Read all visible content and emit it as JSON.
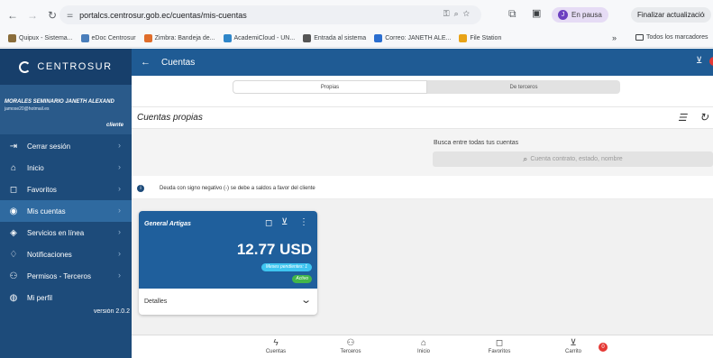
{
  "browser": {
    "url": "portalcs.centrosur.gob.ec/cuentas/mis-cuentas",
    "profile_label": "En pausa",
    "update_label": "Finalizar actualización",
    "bookmarks": [
      {
        "label": "Quipux - Sistema...",
        "color": "#8a6d3b"
      },
      {
        "label": "eDoc Centrosur",
        "color": "#4a7ebb"
      },
      {
        "label": "Zimbra: Bandeja de...",
        "color": "#e06d2b"
      },
      {
        "label": "AcademiCloud - UN...",
        "color": "#2f86c9"
      },
      {
        "label": "Entrada al sistema",
        "color": "#555555"
      },
      {
        "label": "Correo: JANETH ALE...",
        "color": "#2b6ecf"
      },
      {
        "label": "File Station",
        "color": "#e8a317"
      }
    ],
    "more_label": "»",
    "all_bookmarks_label": "Todos los marcadores"
  },
  "sidebar": {
    "brand": "CENTROSUR",
    "user_name": "MORALES SEMINARIO JANETH ALEXAND",
    "user_email": "jamose20@hotmail.es",
    "user_role": "cliente",
    "items": [
      {
        "label": "Cerrar sesión",
        "icon": "logout-icon",
        "glyph": "⇥"
      },
      {
        "label": "Inicio",
        "icon": "home-icon",
        "glyph": "⌂"
      },
      {
        "label": "Favoritos",
        "icon": "bookmark-icon",
        "glyph": "◻"
      },
      {
        "label": "Mis cuentas",
        "icon": "database-icon",
        "glyph": "◉"
      },
      {
        "label": "Servicios en línea",
        "icon": "services-icon",
        "glyph": "◈"
      },
      {
        "label": "Notificaciones",
        "icon": "bell-icon",
        "glyph": "♢"
      },
      {
        "label": "Permisos - Terceros",
        "icon": "users-icon",
        "glyph": "⚇"
      },
      {
        "label": "Mi perfil",
        "icon": "profile-icon",
        "glyph": "◍"
      }
    ],
    "version": "versión 2.0.2"
  },
  "appbar": {
    "title": "Cuentas",
    "back_icon": "arrow-left-icon",
    "cart_icon": "cart-icon"
  },
  "tabs": {
    "own": "Propias",
    "third": "De terceros"
  },
  "section": {
    "title": "Cuentas propias"
  },
  "search": {
    "label": "Busca entre todas tus cuentas",
    "placeholder": "Cuenta contrato, estado, nombre"
  },
  "notice": "Deuda con signo negativo (-) se debe a saldos a favor del cliente",
  "card": {
    "name": "General Artigas",
    "amount": "12.77 USD",
    "pending_badge": "Meses pendientes: 1",
    "status_badge": "Activo",
    "details_label": "Detalles"
  },
  "bottom_nav": [
    {
      "label": "Cuentas",
      "icon": "bolt-icon",
      "glyph": "ϟ"
    },
    {
      "label": "Terceros",
      "icon": "users-icon",
      "glyph": "⚇"
    },
    {
      "label": "Inicio",
      "icon": "home-icon",
      "glyph": "⌂"
    },
    {
      "label": "Favoritos",
      "icon": "bookmark-icon",
      "glyph": "◻"
    },
    {
      "label": "Carrito",
      "icon": "cart-icon",
      "glyph": "⊻"
    }
  ],
  "cart_count": "0",
  "colors": {
    "sidebar": "#1d4b7a",
    "appbar": "#1f5b94",
    "card": "#1f5f9c",
    "accent_badge": "#3ec5f0",
    "status_green": "#43b649",
    "cart_badge": "#e53935"
  }
}
